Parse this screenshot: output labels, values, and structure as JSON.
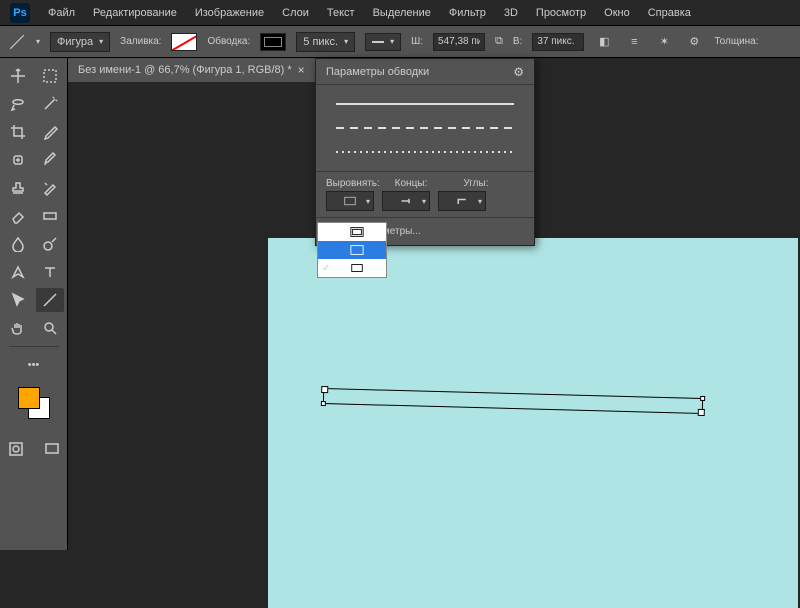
{
  "menu": {
    "items": [
      "Файл",
      "Редактирование",
      "Изображение",
      "Слои",
      "Текст",
      "Выделение",
      "Фильтр",
      "3D",
      "Просмотр",
      "Окно",
      "Справка"
    ]
  },
  "options": {
    "shape": "Фигура",
    "fill": "Заливка:",
    "stroke": "Обводка:",
    "strokeSize": "5 пикс.",
    "w": "Ш:",
    "wVal": "547,38 пи",
    "h": "В:",
    "hVal": "37 пикс.",
    "thickness": "Толщина:"
  },
  "doc": {
    "title": "Без имени-1 @ 66,7% (Фигура 1, RGB/8) *"
  },
  "popup": {
    "title": "Параметры обводки",
    "align": "Выровнять:",
    "caps": "Концы:",
    "corners": "Углы:",
    "more": "Другие параметры..."
  }
}
